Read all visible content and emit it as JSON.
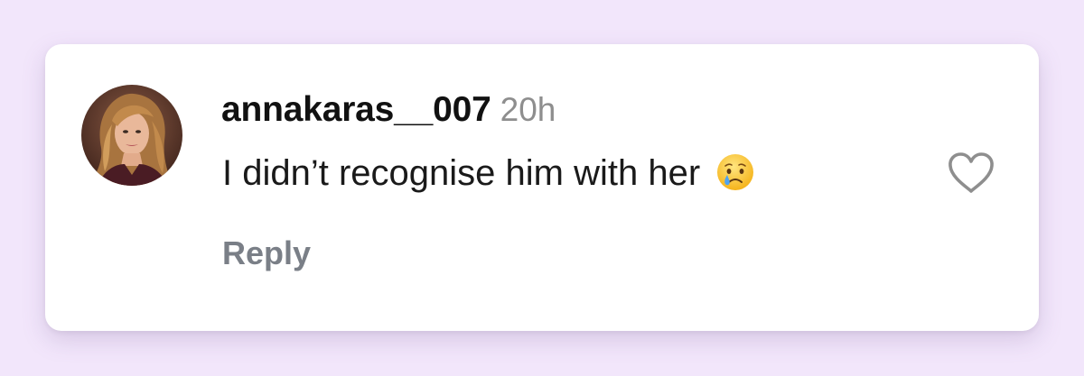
{
  "comment": {
    "username": "annakaras__007",
    "timestamp": "20h",
    "text": "I didn’t recognise him with her",
    "emoji_icon": "crying-face-icon",
    "reply_label": "Reply",
    "like_icon": "heart-outline-icon",
    "liked": false
  },
  "colors": {
    "page_background": "#f2e6fb",
    "card_background": "#ffffff",
    "username": "#111111",
    "timestamp": "#8e8e8e",
    "reply": "#7a7f87",
    "heart_stroke": "#8e8e8e"
  }
}
